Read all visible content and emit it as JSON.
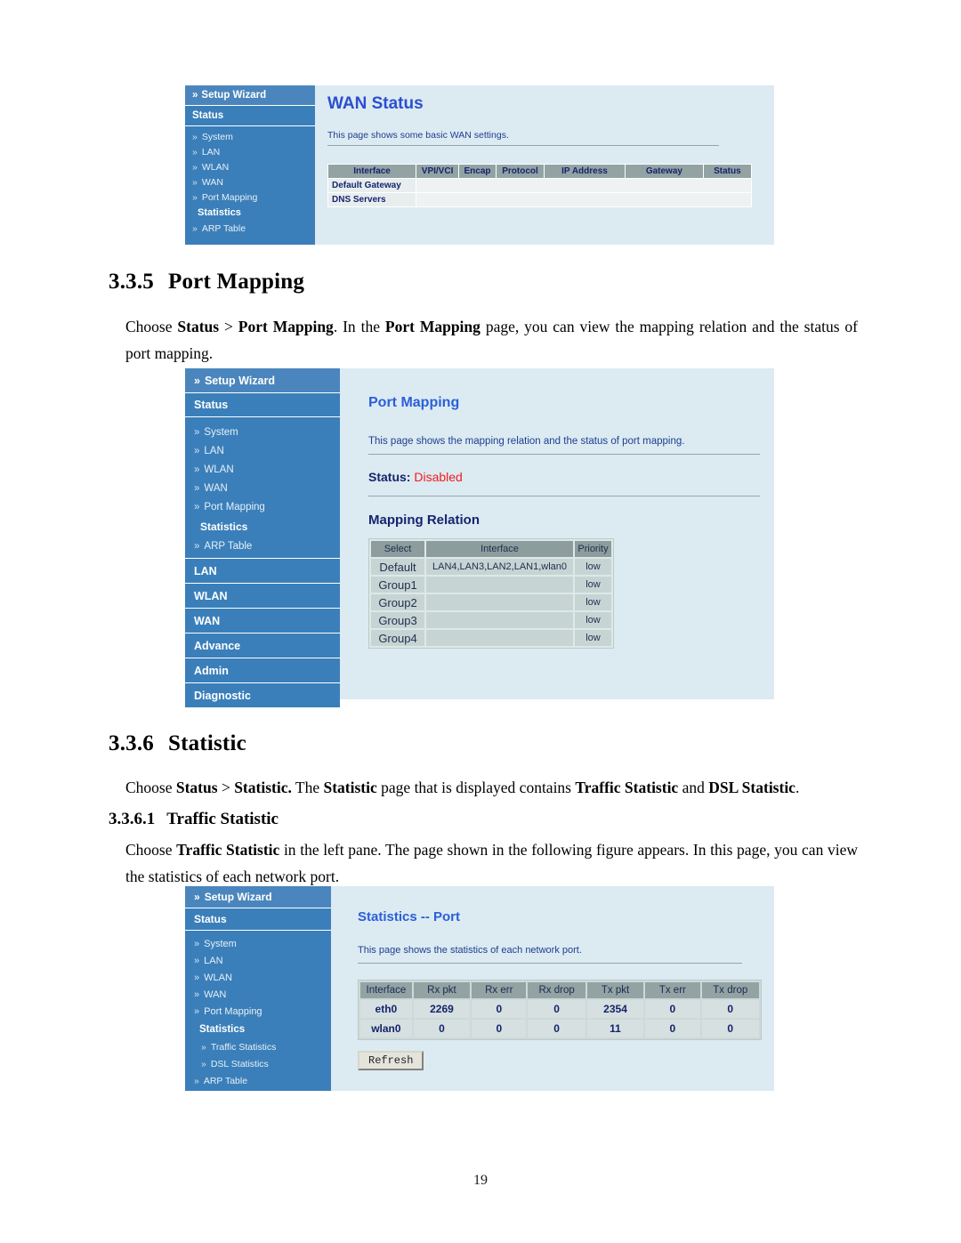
{
  "page": {
    "number": "19"
  },
  "section_port_mapping": {
    "heading_num": "3.3.5",
    "heading_text": "Port Mapping",
    "paragraph": {
      "p1": "Choose ",
      "b1": "Status",
      "p2": " > ",
      "b2": "Port Mapping",
      "p3": ". In the ",
      "b3": "Port Mapping",
      "p4": " page, you can view the mapping relation and the status of port mapping."
    }
  },
  "section_statistic": {
    "heading_num": "3.3.6",
    "heading_text": "Statistic",
    "paragraph": {
      "p1": "Choose ",
      "b1": "Status",
      "p2": " > ",
      "b2": "Statistic.",
      "p3": " The ",
      "b3": "Statistic",
      "p4": " page that is displayed contains ",
      "b4": "Traffic Statistic",
      "p5": " and ",
      "b5": "DSL Statistic",
      "p6": "."
    },
    "sub": {
      "heading_num": "3.3.6.1",
      "heading_text": "Traffic Statistic",
      "paragraph": {
        "p1": "Choose ",
        "b1": "Traffic Statistic",
        "p2": " in the left pane. The page shown in the following figure appears. In this page, you can view the statistics of each network port."
      }
    }
  },
  "shot_wan_status": {
    "sidebar": {
      "setup_wizard": "Setup Wizard",
      "status": "Status",
      "items": [
        {
          "label": "System",
          "type": "sub"
        },
        {
          "label": "LAN",
          "type": "sub"
        },
        {
          "label": "WLAN",
          "type": "sub"
        },
        {
          "label": "WAN",
          "type": "sub"
        },
        {
          "label": "Port Mapping",
          "type": "sub"
        },
        {
          "label": "Statistics",
          "type": "sub-bold"
        },
        {
          "label": "ARP Table",
          "type": "sub"
        }
      ]
    },
    "title": "WAN Status",
    "description": "This page shows some basic WAN settings.",
    "table": {
      "headers": [
        "Interface",
        "VPI/VCI",
        "Encap",
        "Protocol",
        "IP Address",
        "Gateway",
        "Status"
      ],
      "rows": [
        {
          "label": "Default Gateway",
          "cells": [
            "",
            "",
            "",
            "",
            "",
            ""
          ]
        },
        {
          "label": "DNS Servers",
          "cells": [
            "",
            "",
            "",
            "",
            "",
            ""
          ]
        }
      ]
    }
  },
  "shot_port_mapping": {
    "sidebar": {
      "setup_wizard": "Setup Wizard",
      "status": "Status",
      "items": [
        {
          "label": "System",
          "type": "sub"
        },
        {
          "label": "LAN",
          "type": "sub"
        },
        {
          "label": "WLAN",
          "type": "sub"
        },
        {
          "label": "WAN",
          "type": "sub"
        },
        {
          "label": "Port Mapping",
          "type": "sub"
        },
        {
          "label": "Statistics",
          "type": "sub-bold"
        },
        {
          "label": "ARP Table",
          "type": "sub"
        }
      ],
      "sections": [
        "LAN",
        "WLAN",
        "WAN",
        "Advance",
        "Admin",
        "Diagnostic"
      ]
    },
    "title": "Port Mapping",
    "description": "This page shows the mapping relation and the status of port mapping.",
    "status_label": "Status:",
    "status_value": "Disabled",
    "section_title": "Mapping Relation",
    "table": {
      "headers": [
        "Select",
        "Interface",
        "Priority"
      ],
      "rows": [
        {
          "select": "Default",
          "interface": "LAN4,LAN3,LAN2,LAN1,wlan0",
          "priority": "low"
        },
        {
          "select": "Group1",
          "interface": "",
          "priority": "low"
        },
        {
          "select": "Group2",
          "interface": "",
          "priority": "low"
        },
        {
          "select": "Group3",
          "interface": "",
          "priority": "low"
        },
        {
          "select": "Group4",
          "interface": "",
          "priority": "low"
        }
      ]
    }
  },
  "shot_statistics": {
    "sidebar": {
      "setup_wizard": "Setup Wizard",
      "status": "Status",
      "items": [
        {
          "label": "System",
          "type": "sub"
        },
        {
          "label": "LAN",
          "type": "sub"
        },
        {
          "label": "WLAN",
          "type": "sub"
        },
        {
          "label": "WAN",
          "type": "sub"
        },
        {
          "label": "Port Mapping",
          "type": "sub"
        },
        {
          "label": "Statistics",
          "type": "sub-bold"
        },
        {
          "label": "Traffic Statistics",
          "type": "sub-indent"
        },
        {
          "label": "DSL Statistics",
          "type": "sub-indent"
        },
        {
          "label": "ARP Table",
          "type": "sub"
        }
      ]
    },
    "title": "Statistics -- Port",
    "description": "This page shows the statistics of each network port.",
    "table": {
      "headers": [
        "Interface",
        "Rx pkt",
        "Rx err",
        "Rx drop",
        "Tx pkt",
        "Tx err",
        "Tx drop"
      ],
      "rows": [
        {
          "cells": [
            "eth0",
            "2269",
            "0",
            "0",
            "2354",
            "0",
            "0"
          ]
        },
        {
          "cells": [
            "wlan0",
            "0",
            "0",
            "0",
            "11",
            "0",
            "0"
          ]
        }
      ]
    },
    "refresh_label": "Refresh"
  },
  "colors": {
    "sidebar_blue": "#3a7fba",
    "pane_bg": "#dceaf2",
    "title_blue": "#2b5fd9",
    "status_red": "#f01c1c",
    "table_header": "#93a3a3"
  }
}
